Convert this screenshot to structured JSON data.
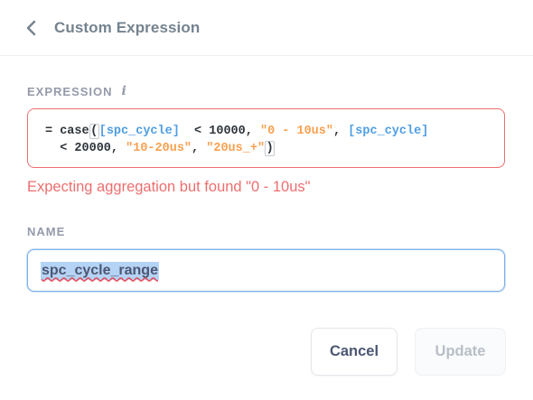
{
  "header": {
    "title": "Custom Expression",
    "back_icon": "chevron-left-icon"
  },
  "expression": {
    "label": "EXPRESSION",
    "info_icon_glyph": "i",
    "line1": {
      "prefix": "= case",
      "open_paren": "(",
      "field1": "[spc_cycle]",
      "op1": "  < 10000, ",
      "str1": "\"0 - 10us\"",
      "comma1": ", ",
      "field2": "[spc_cycle]"
    },
    "line2": {
      "indent": "  ",
      "op2": "< 20000, ",
      "str2": "\"10-20us\"",
      "comma2": ", ",
      "str3": "\"20us_+\"",
      "close_paren": ")"
    },
    "error": "Expecting aggregation but found \"0 - 10us\""
  },
  "name": {
    "label": "NAME",
    "value": "spc_cycle_range"
  },
  "buttons": {
    "cancel": "Cancel",
    "update": "Update"
  },
  "colors": {
    "error": "#ed6e6e",
    "field_token": "#509ee3",
    "string_token": "#f9a050",
    "focus_border": "#7fb1e8"
  }
}
